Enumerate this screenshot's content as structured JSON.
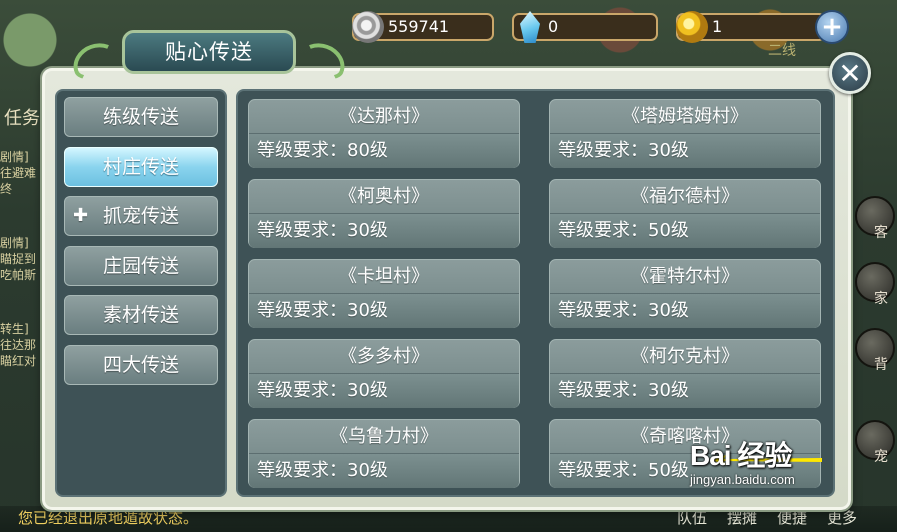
{
  "currency": {
    "silver": "559741",
    "diamond": "0",
    "gold": "1",
    "line": "二线"
  },
  "dialog": {
    "title": "贴心传送",
    "close_symbol": "✕"
  },
  "sidebar": {
    "items": [
      {
        "label": "练级传送",
        "active": false
      },
      {
        "label": "村庄传送",
        "active": true
      },
      {
        "label": "抓宠传送",
        "active": false,
        "badge": "✚"
      },
      {
        "label": "庄园传送",
        "active": false
      },
      {
        "label": "素材传送",
        "active": false
      },
      {
        "label": "四大传送",
        "active": false
      }
    ]
  },
  "villages": [
    {
      "name": "《达那村》",
      "req": "等级要求：80级"
    },
    {
      "name": "《塔姆塔姆村》",
      "req": "等级要求：30级"
    },
    {
      "name": "《柯奥村》",
      "req": "等级要求：30级"
    },
    {
      "name": "《福尔德村》",
      "req": "等级要求：50级"
    },
    {
      "name": "《卡坦村》",
      "req": "等级要求：30级"
    },
    {
      "name": "《霍特尔村》",
      "req": "等级要求：30级"
    },
    {
      "name": "《多多村》",
      "req": "等级要求：30级"
    },
    {
      "name": "《柯尔克村》",
      "req": "等级要求：30级"
    },
    {
      "name": "《乌鲁力村》",
      "req": "等级要求：30级"
    },
    {
      "name": "《奇喀喀村》",
      "req": "等级要求：50级"
    }
  ],
  "background": {
    "task_label": "任务",
    "left_snippets": [
      "剧情]",
      "往避难",
      "终",
      "剧情]",
      "瞄捉到",
      "吃帕斯",
      "转生]",
      "往达那",
      "瞄红对"
    ],
    "bottom_message": "您已经退出原地遁故状态。",
    "bottom_buttons": [
      "队伍",
      "摆摊",
      "便捷",
      "更多"
    ],
    "right_buttons": [
      "客",
      "家",
      "背",
      "宠"
    ]
  },
  "watermark": {
    "logo": "Bai  经验",
    "url": "jingyan.baidu.com"
  },
  "icons": {
    "silver": "silver-coin-icon",
    "diamond": "crystal-icon",
    "gold": "gold-coin-icon",
    "add": "plus-icon",
    "close": "close-icon"
  }
}
